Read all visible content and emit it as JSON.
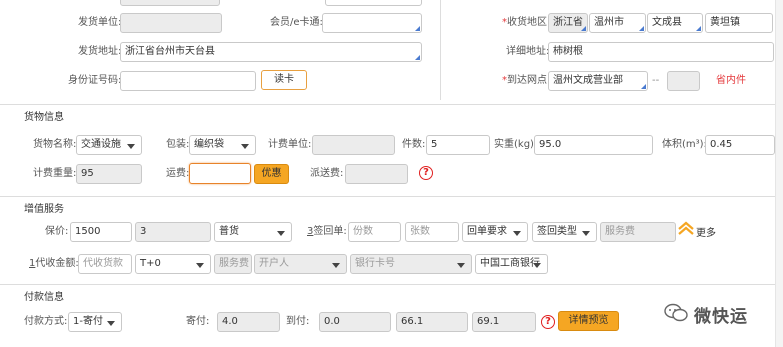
{
  "sender": {
    "unit_label": "发货单位:",
    "address_label": "发货地址:",
    "address_value": "浙江省台州市天台县",
    "id_label": "身份证号码:",
    "read_card": "读卡",
    "member_label": "会员/e卡通:"
  },
  "receiver": {
    "region_label": "收货地区:",
    "province": "浙江省",
    "city": "温州市",
    "county": "文成县",
    "town": "黄坦镇",
    "detail_label": "详细地址:",
    "detail_value": "柿树根",
    "arrival_label": "到达网点:",
    "arrival_value": "温州文成营业部",
    "dash": "--",
    "province_hint": "省内件"
  },
  "cargo": {
    "section_title": "货物信息",
    "name_label": "货物名称:",
    "name_value": "交通设施",
    "pack_label": "包装:",
    "pack_value": "编织袋",
    "billing_unit_label": "计费单位:",
    "pieces_label": "件数:",
    "pieces_value": "5",
    "weight_label": "实重(kg):",
    "weight_value": "95.0",
    "volume_label": "体积(m³):",
    "volume_value": "0.45",
    "billing_weight_label": "计费重量:",
    "billing_weight_value": "95",
    "freight_label": "运费:",
    "discount_btn": "优惠",
    "delivery_fee_label": "派送费:",
    "help": "?"
  },
  "value_added": {
    "section_title": "增值服务",
    "insured_label": "保价:",
    "insured_value": "1500",
    "insured_rate": "3",
    "goods_type": "普货",
    "sign_label": "签回单:",
    "sign_num": "3",
    "copies_ph": "份数",
    "sheets_ph": "张数",
    "receipt_req": "回单要求",
    "receipt_type": "签回类型",
    "service_fee": "服务费",
    "more": "更多",
    "cod_num": "1",
    "cod_label": "代收金额:",
    "cod_ph": "代收货款",
    "cod_term": "T+0",
    "cod_service_fee": "服务费",
    "account_holder": "开户人",
    "bank_card": "银行卡号",
    "bank": "中国工商银行"
  },
  "payment": {
    "section_title": "付款信息",
    "method_label": "付款方式:",
    "method_value": "1-寄付",
    "prepaid_label": "寄付:",
    "prepaid_value": "4.0",
    "collect_label": "到付:",
    "collect_value": "0.0",
    "amount_a": "66.1",
    "amount_b": "69.1",
    "help": "?",
    "preview_btn": "详情预览"
  },
  "watermark": {
    "text": "微快运"
  },
  "colors": {
    "orange": "#f5a623",
    "red": "#e4393c",
    "accent_blue": "#4a7bd0"
  }
}
